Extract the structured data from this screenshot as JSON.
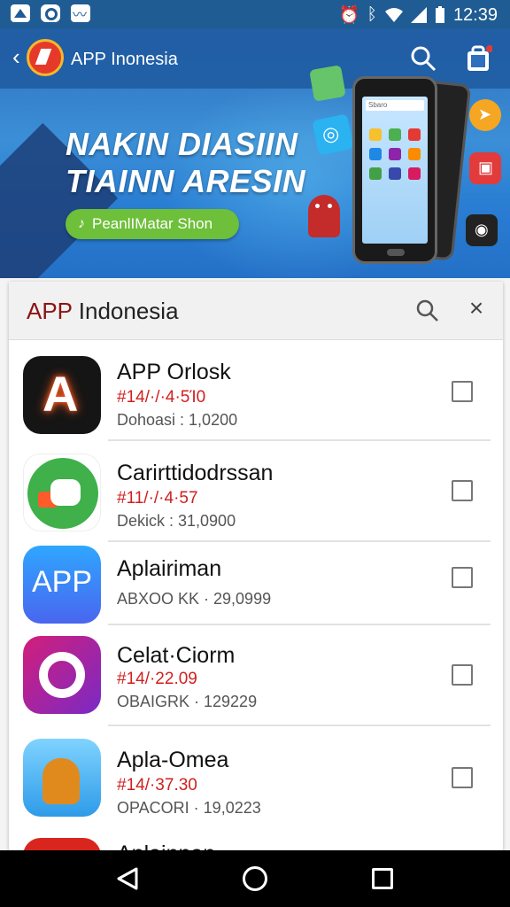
{
  "statusbar": {
    "time": "12:39",
    "icons": [
      "image-icon",
      "ring-icon",
      "mail-icon",
      "alarm-icon",
      "bluetooth-icon",
      "wifi-icon",
      "signal-icon",
      "battery-icon"
    ]
  },
  "appbar": {
    "title": "APP Inonesia"
  },
  "banner": {
    "headline_line1": "NAKIN DIASIIN",
    "headline_line2": "TIAINN ARESIN",
    "cta_label": "PeanlIMatar Shon",
    "phone_search_text": "Sbaro"
  },
  "panel": {
    "title_accent": "APP",
    "title_rest": " Indonesia"
  },
  "apps": [
    {
      "name": "APP Orlosk",
      "meta_red": "#14/·/·4·5Ί0",
      "meta": "Dohoasi : 1,0200",
      "icon": "atom-a-icon"
    },
    {
      "name": "Carirttidodrssan",
      "meta_red": "#11/·/·4·57",
      "meta": "Dekick : 31,0900",
      "icon": "green-robot-icon"
    },
    {
      "name": "Aplairiman",
      "meta_red": "",
      "meta": "ABXOO KK · 29,0999",
      "icon": "app-blue-icon"
    },
    {
      "name": "Celat·Ciorm",
      "meta_red": "#14/·22.09",
      "meta": "OBAIGRK · 129229",
      "icon": "gear-purple-icon"
    },
    {
      "name": "Apla-Omea",
      "meta_red": "#14/·37.30",
      "meta": "OPACORI · 19,0223",
      "icon": "android-robot-icon"
    },
    {
      "name": "Aplainnan",
      "meta_red": "",
      "meta": "",
      "icon": "red-app-icon"
    }
  ],
  "colors": {
    "status_bar": "#1f5c93",
    "accent_red": "#d11f1f",
    "cta_green": "#6ebf3a"
  }
}
